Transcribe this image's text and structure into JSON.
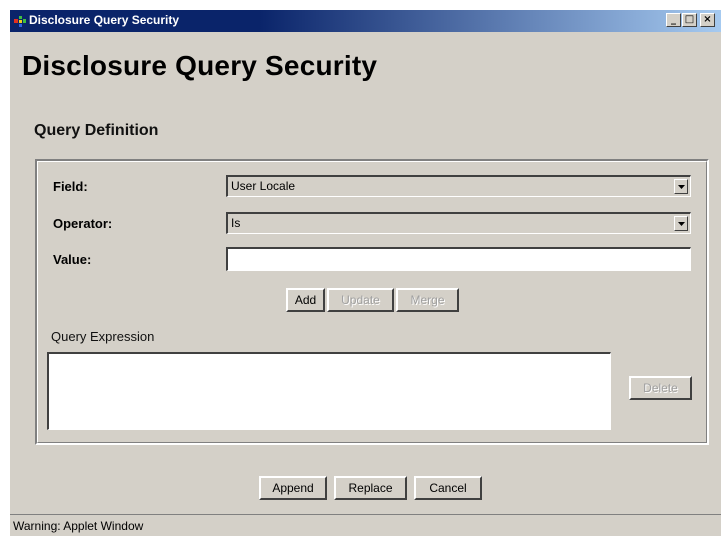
{
  "window": {
    "title": "Disclosure Query Security",
    "controls": {
      "minimize": "_",
      "maximize": "□",
      "close": "×"
    }
  },
  "page": {
    "heading": "Disclosure Query Security",
    "section_title": "Query Definition"
  },
  "form": {
    "field": {
      "label": "Field:",
      "value": "User Locale"
    },
    "operator": {
      "label": "Operator:",
      "value": "Is"
    },
    "value": {
      "label": "Value:",
      "value": ""
    }
  },
  "actions": {
    "add": "Add",
    "update": "Update",
    "merge": "Merge"
  },
  "query_expression": {
    "label": "Query Expression",
    "value": "",
    "delete": "Delete"
  },
  "footer": {
    "append": "Append",
    "replace": "Replace",
    "cancel": "Cancel"
  },
  "status": {
    "text": "Warning: Applet Window"
  },
  "colors": {
    "titlebar": "#0a246a",
    "face": "#d4d0c8",
    "disabled_text": "#a0a0a0"
  },
  "icons": {
    "app": "java-applet-icon",
    "dropdown": "chevron-down-icon"
  }
}
